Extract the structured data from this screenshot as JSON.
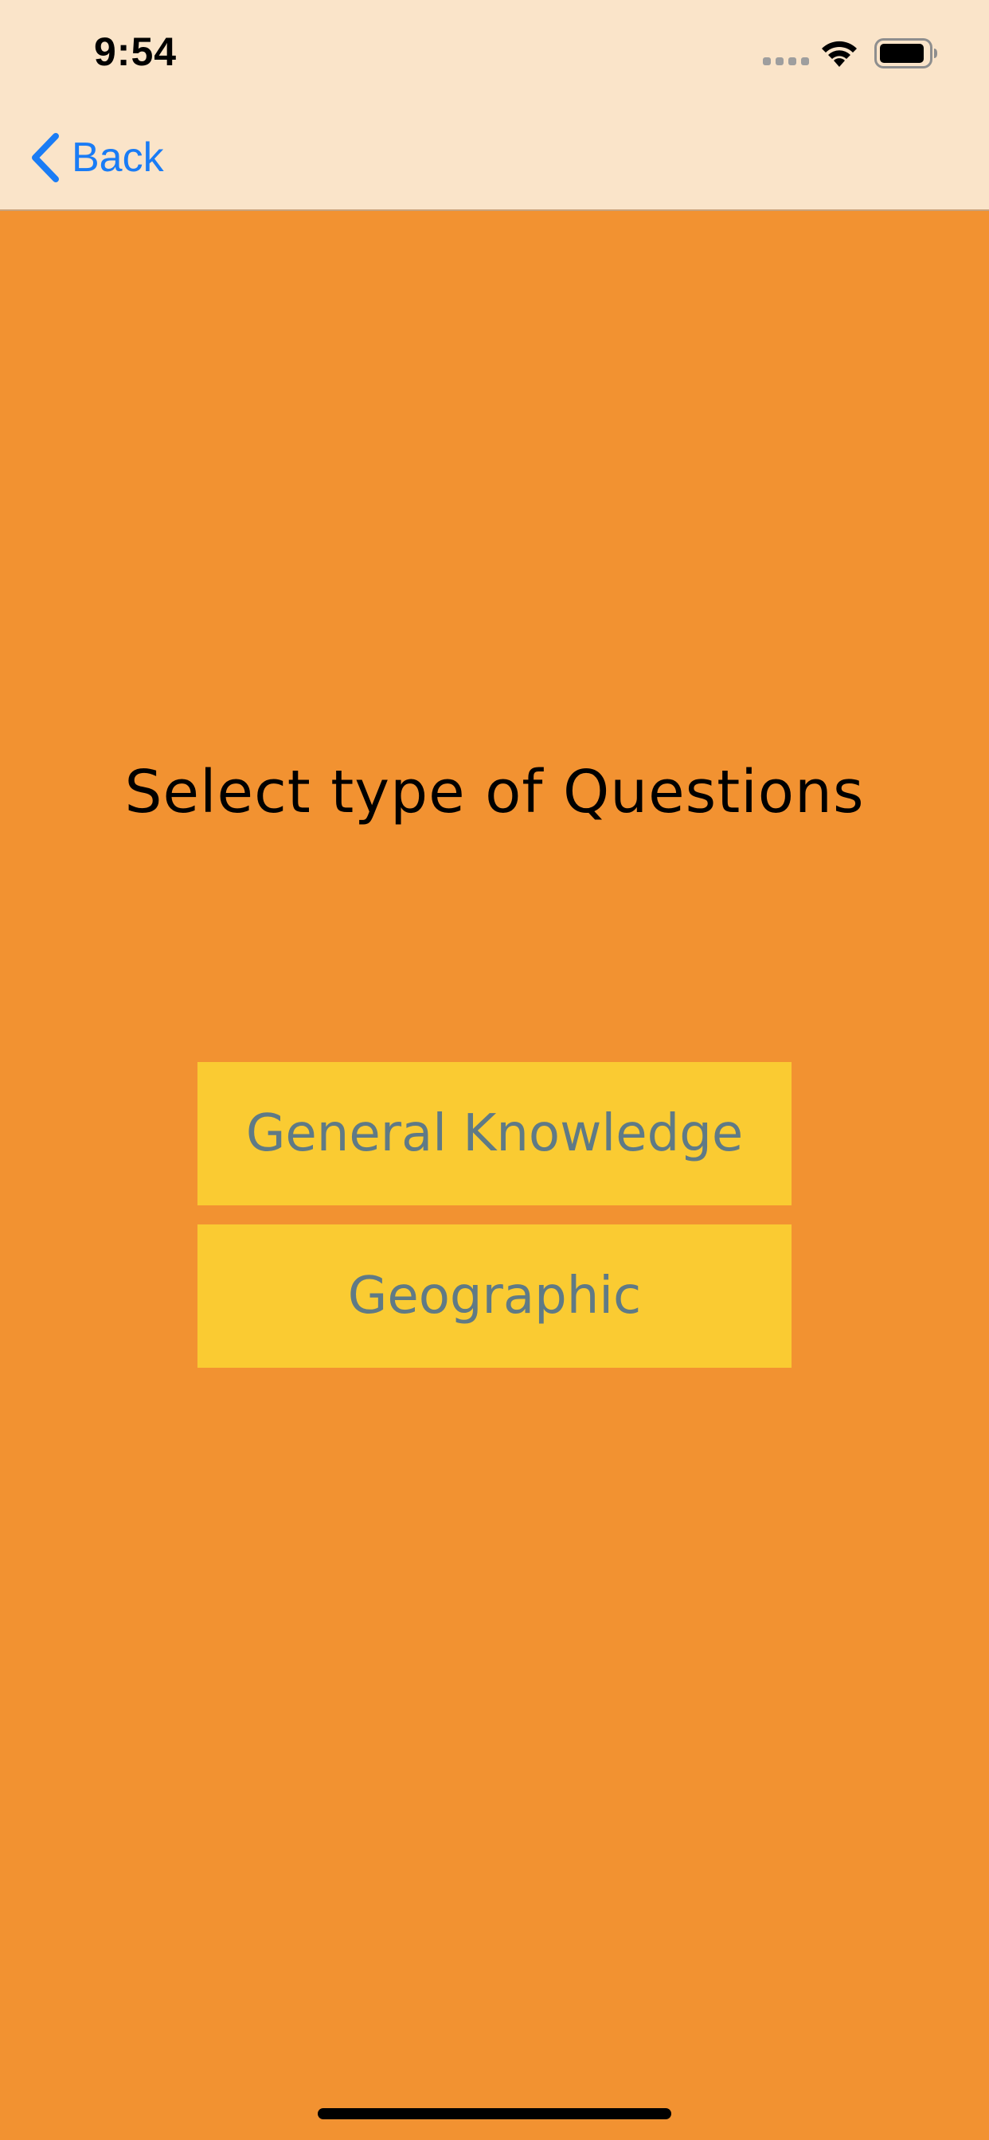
{
  "status_bar": {
    "time": "9:54"
  },
  "nav": {
    "back_label": "Back"
  },
  "main": {
    "title": "Select type of Questions",
    "buttons": [
      {
        "label": "General Knowledge"
      },
      {
        "label": "Geographic"
      }
    ]
  },
  "colors": {
    "background": "#F29231",
    "top_bar": "#FAE4C9",
    "button": "#FACB32",
    "button_text": "#5F7A86",
    "link": "#1A7CF5"
  },
  "icons": {
    "back": "chevron-left-icon",
    "signal": "cellular-signal-icon",
    "wifi": "wifi-icon",
    "battery": "battery-icon"
  }
}
